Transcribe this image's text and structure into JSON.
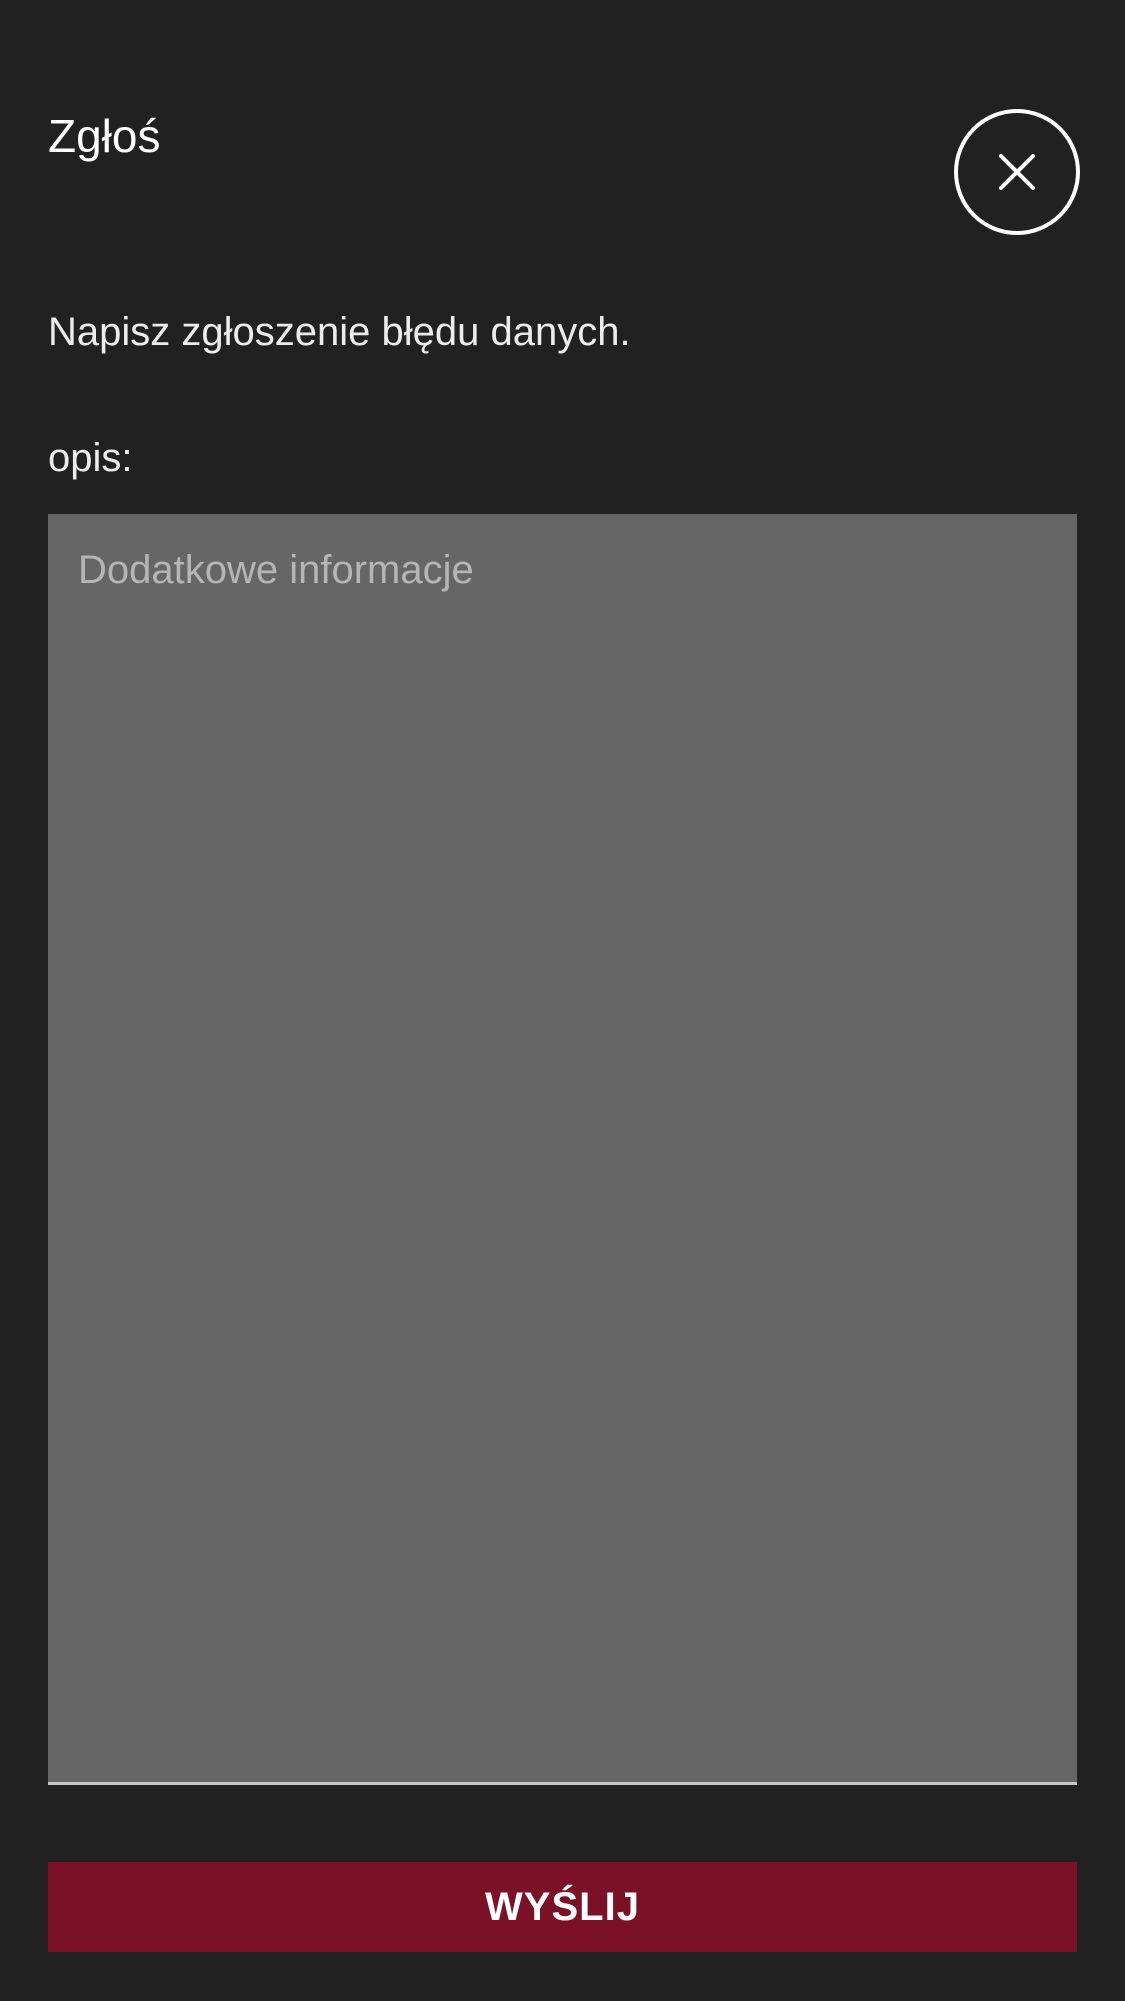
{
  "dialog": {
    "title": "Zgłoś",
    "close_icon": "close-icon",
    "message": "Napisz zgłoszenie błędu danych.",
    "description_label": "opis:",
    "description_placeholder": "Dodatkowe informacje",
    "description_value": "",
    "submit_label": "WYŚLIJ"
  },
  "colors": {
    "background": "#212121",
    "textarea_background": "#666666",
    "submit_background": "#7b1126",
    "text": "#ffffff"
  }
}
